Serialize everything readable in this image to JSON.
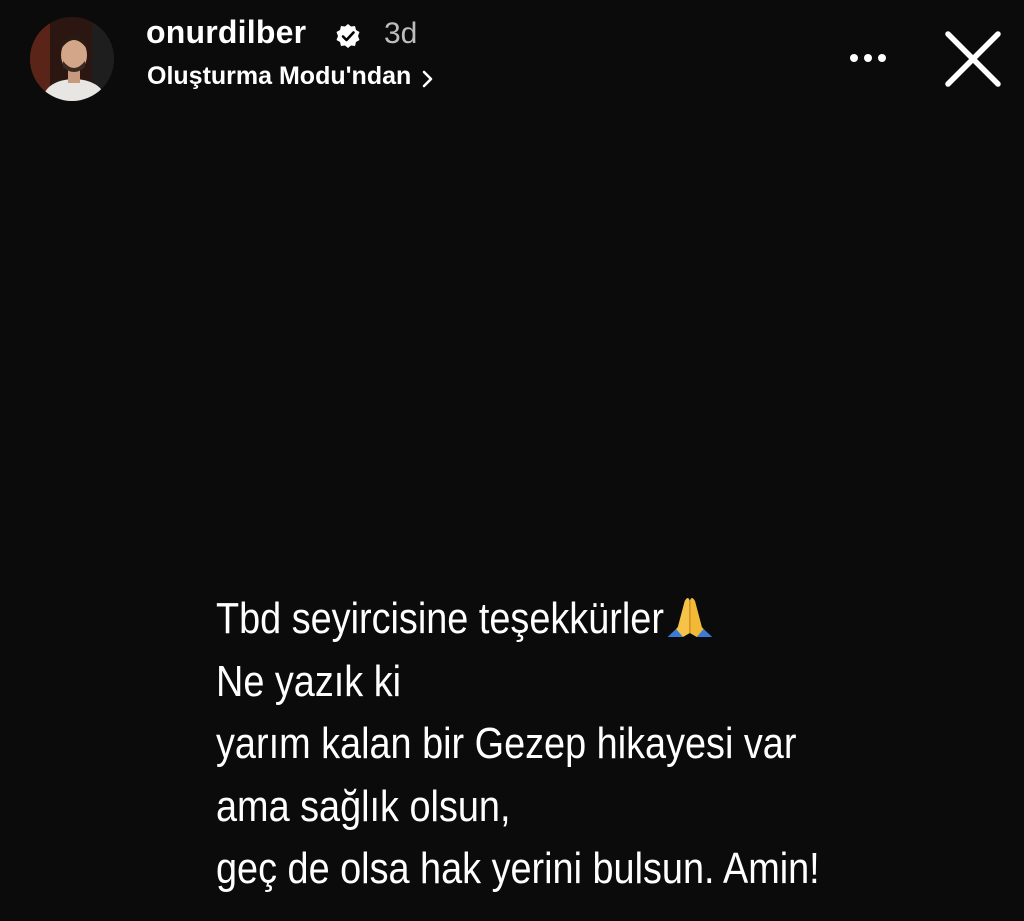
{
  "header": {
    "username": "onurdilber",
    "time_ago": "3d",
    "subtitle": "Oluşturma Modu'ndan"
  },
  "message": {
    "lines": [
      "Tbd seyircisine teşekkürler",
      "Ne yazık ki",
      "yarım kalan bir Gezep hikayesi var",
      "ama sağlık olsun,",
      "geç de olsa hak yerini bulsun. Amin!"
    ]
  },
  "icons": {
    "verified": "verified-badge-icon",
    "chevron": "chevron-right-icon",
    "more": "more-options-icon",
    "close": "close-icon",
    "pray": "folded-hands-emoji-icon"
  },
  "colors": {
    "background": "#0b0b0b",
    "text": "#ffffff",
    "muted_text": "#bdbdbd"
  }
}
